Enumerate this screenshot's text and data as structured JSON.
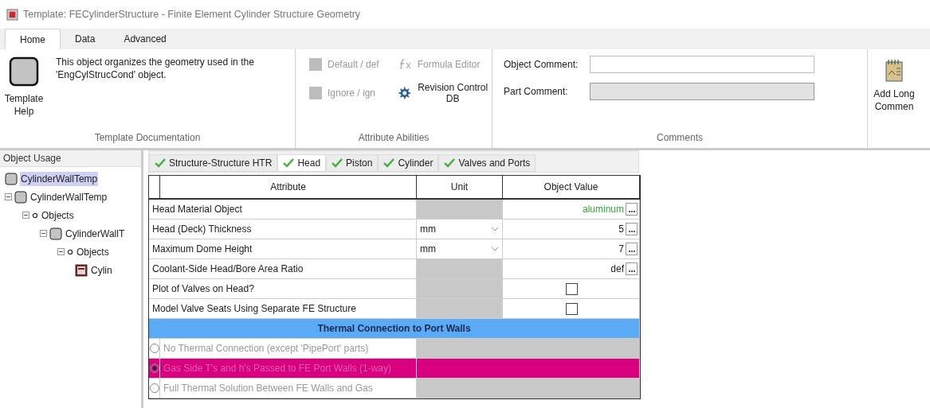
{
  "window": {
    "title": "Template: FECylinderStructure - Finite Element Cylinder Structure Geometry"
  },
  "ribbon_tabs": [
    {
      "label": "Home",
      "selected": true
    },
    {
      "label": "Data",
      "selected": false
    },
    {
      "label": "Advanced",
      "selected": false
    }
  ],
  "template_documentation": {
    "label": "Template Documentation",
    "help_button": "Template Help",
    "description": "This object organizes the geometry used in the 'EngCylStrucCond' object."
  },
  "attribute_abilities": {
    "label": "Attribute Abilities",
    "items": [
      {
        "label": "Default / def",
        "kind": "toggle",
        "disabled": true
      },
      {
        "label": "Formula Editor",
        "kind": "formula",
        "disabled": true
      },
      {
        "label": "Ignore / ign",
        "kind": "toggle",
        "disabled": true
      },
      {
        "label": "Revision Control DB",
        "kind": "gear",
        "disabled": false
      }
    ]
  },
  "comments": {
    "label": "Comments",
    "fields": [
      {
        "label": "Object Comment:",
        "disabled": false
      },
      {
        "label": "Part Comment:",
        "disabled": true
      }
    ],
    "add_button": "Add Long Commen"
  },
  "object_usage": {
    "title": "Object Usage",
    "tree": [
      {
        "label": "CylinderWallTemp",
        "kind": "template",
        "selected": true
      },
      {
        "label": "CylinderWallTemp",
        "kind": "template",
        "selected": false,
        "expanded": true,
        "children": [
          {
            "label": "Objects",
            "kind": "folder",
            "selected": false,
            "expanded": true,
            "children": [
              {
                "label": "CylinderWallT",
                "kind": "template",
                "selected": false,
                "expanded": true,
                "children": [
                  {
                    "label": "Objects",
                    "kind": "folder",
                    "selected": false,
                    "expanded": true,
                    "children": [
                      {
                        "label": "Cylin",
                        "kind": "object",
                        "selected": false
                      }
                    ]
                  }
                ]
              }
            ]
          }
        ]
      }
    ]
  },
  "sub_tabs": [
    {
      "label": "Structure-Structure HTR",
      "selected": false
    },
    {
      "label": "Head",
      "selected": true
    },
    {
      "label": "Piston",
      "selected": false
    },
    {
      "label": "Cylinder",
      "selected": false
    },
    {
      "label": "Valves and Ports",
      "selected": false
    }
  ],
  "table": {
    "columns": [
      "Attribute",
      "Unit",
      "Object Value"
    ],
    "rows": [
      {
        "kind": "value",
        "attribute": "Head Material Object",
        "value": "aluminum",
        "linked": true
      },
      {
        "kind": "value",
        "attribute": "Head (Deck) Thickness",
        "unit": "mm",
        "value": "5",
        "linked": false
      },
      {
        "kind": "value",
        "attribute": "Maximum Dome Height",
        "unit": "mm",
        "value": "7",
        "linked": false
      },
      {
        "kind": "value",
        "attribute": "Coolant-Side Head/Bore Area Ratio",
        "value": "def",
        "linked": false
      },
      {
        "kind": "checkbox",
        "attribute": "Plot of Valves on Head?",
        "checked": false
      },
      {
        "kind": "checkbox",
        "attribute": "Model Valve Seats Using Separate FE Structure",
        "checked": false
      },
      {
        "kind": "section",
        "attribute": "Thermal Connection to Port Walls"
      },
      {
        "kind": "option",
        "attribute": "No Thermal Connection (except 'PipePort' parts)",
        "selected": false
      },
      {
        "kind": "option",
        "attribute": "Gas Side T's and h's Passed to FE Port Walls (1-way)",
        "selected": true
      },
      {
        "kind": "option",
        "attribute": "Full Thermal Solution Between FE Walls and Gas",
        "selected": false
      }
    ]
  }
}
